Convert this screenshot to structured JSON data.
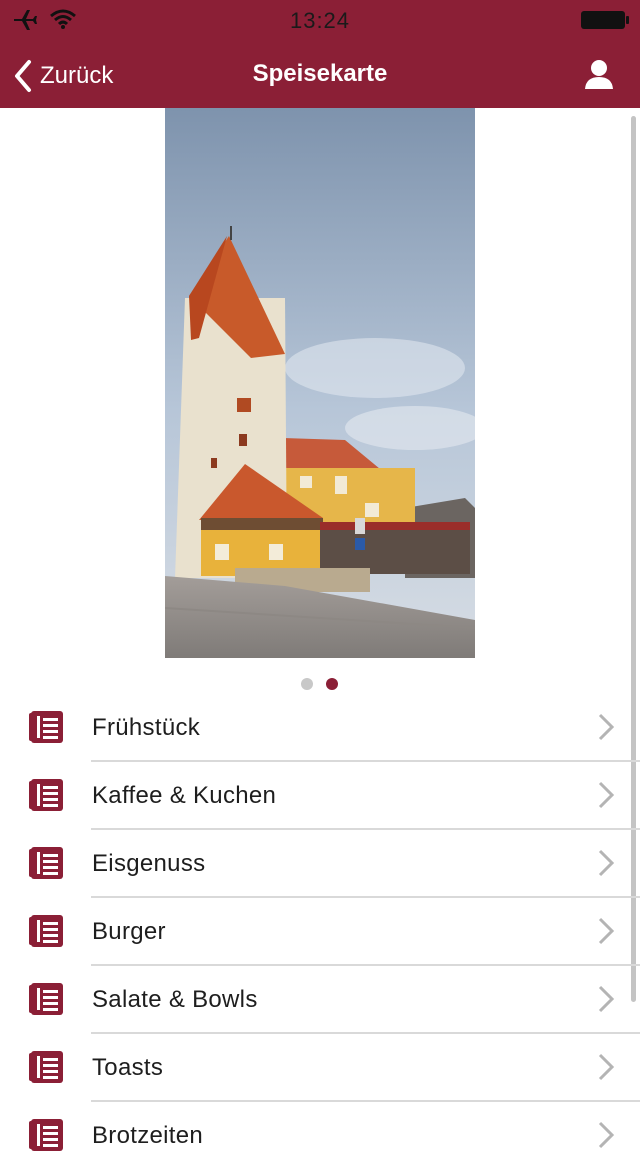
{
  "status_bar": {
    "time": "13:24"
  },
  "nav": {
    "back_label": "Zurück",
    "title": "Speisekarte"
  },
  "carousel": {
    "pages": 2,
    "current_page": 2
  },
  "menu": {
    "items": [
      {
        "label": "Frühstück"
      },
      {
        "label": "Kaffee & Kuchen"
      },
      {
        "label": "Eisgenuss"
      },
      {
        "label": "Burger"
      },
      {
        "label": "Salate & Bowls"
      },
      {
        "label": "Toasts"
      },
      {
        "label": "Brotzeiten"
      }
    ]
  },
  "colors": {
    "brand": "#8b1f36",
    "separator": "#d9d9d9",
    "chevron": "#b4b4b4"
  },
  "icons": {
    "back": "chevron-left-icon",
    "profile": "user-icon",
    "menu_item": "menu-list-icon",
    "row_arrow": "chevron-right-icon"
  }
}
